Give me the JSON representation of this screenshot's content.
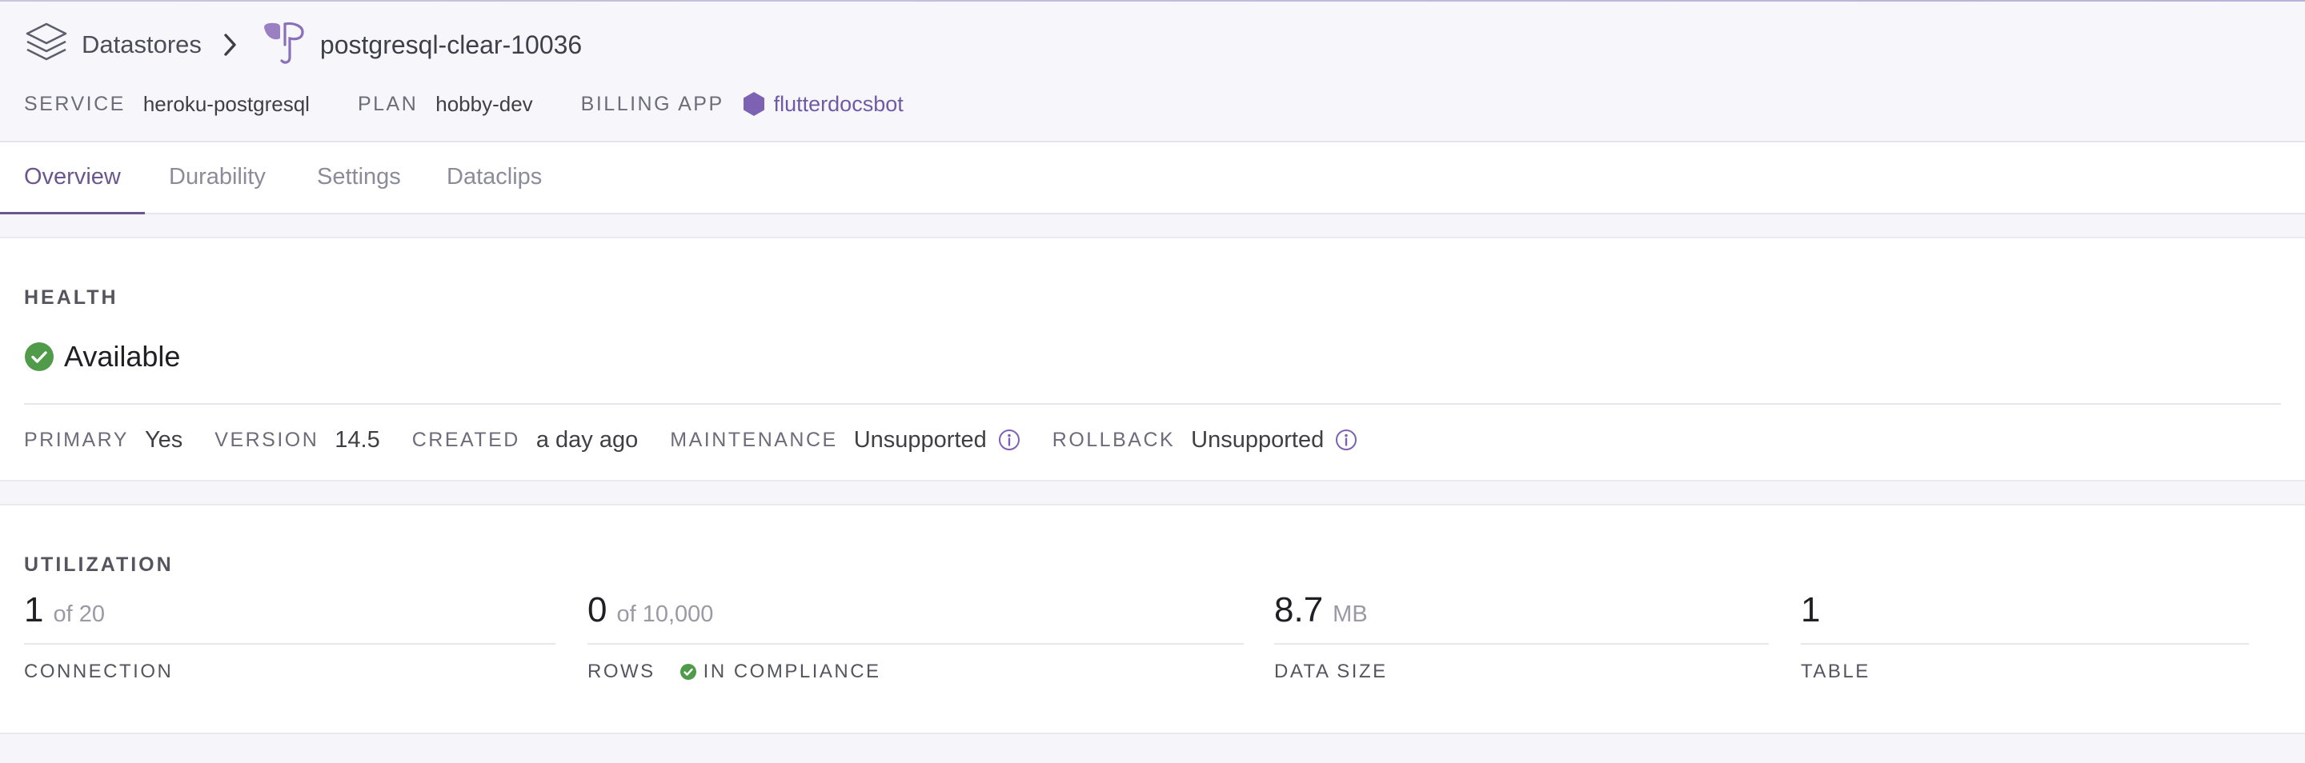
{
  "breadcrumb": {
    "parent": "Datastores",
    "title": "postgresql-clear-10036"
  },
  "meta": {
    "service_label": "SERVICE",
    "service_value": "heroku-postgresql",
    "plan_label": "PLAN",
    "plan_value": "hobby-dev",
    "billing_label": "BILLING APP",
    "billing_value": "flutterdocsbot"
  },
  "tabs": [
    {
      "label": "Overview",
      "active": true
    },
    {
      "label": "Durability",
      "active": false
    },
    {
      "label": "Settings",
      "active": false
    },
    {
      "label": "Dataclips",
      "active": false
    }
  ],
  "health": {
    "heading": "HEALTH",
    "status": "Available",
    "primary_label": "PRIMARY",
    "primary_value": "Yes",
    "version_label": "VERSION",
    "version_value": "14.5",
    "created_label": "CREATED",
    "created_value": "a day ago",
    "maintenance_label": "MAINTENANCE",
    "maintenance_value": "Unsupported",
    "rollback_label": "ROLLBACK",
    "rollback_value": "Unsupported"
  },
  "utilization": {
    "heading": "UTILIZATION",
    "connection": {
      "value": "1",
      "of": "of 20",
      "label": "CONNECTION"
    },
    "rows": {
      "value": "0",
      "of": "of 10,000",
      "label": "ROWS",
      "compliance": "IN COMPLIANCE"
    },
    "data_size": {
      "value": "8.7",
      "unit": "MB",
      "label": "DATA SIZE"
    },
    "table": {
      "value": "1",
      "label": "TABLE"
    }
  },
  "colors": {
    "accent": "#6b568f",
    "success": "#4f9b4a",
    "app_hex": "#7d62b3"
  },
  "icons": [
    "datastores-icon",
    "chevron-right-icon",
    "postgres-elephant-icon",
    "hexagon-app-icon",
    "check-circle-icon",
    "info-icon"
  ]
}
